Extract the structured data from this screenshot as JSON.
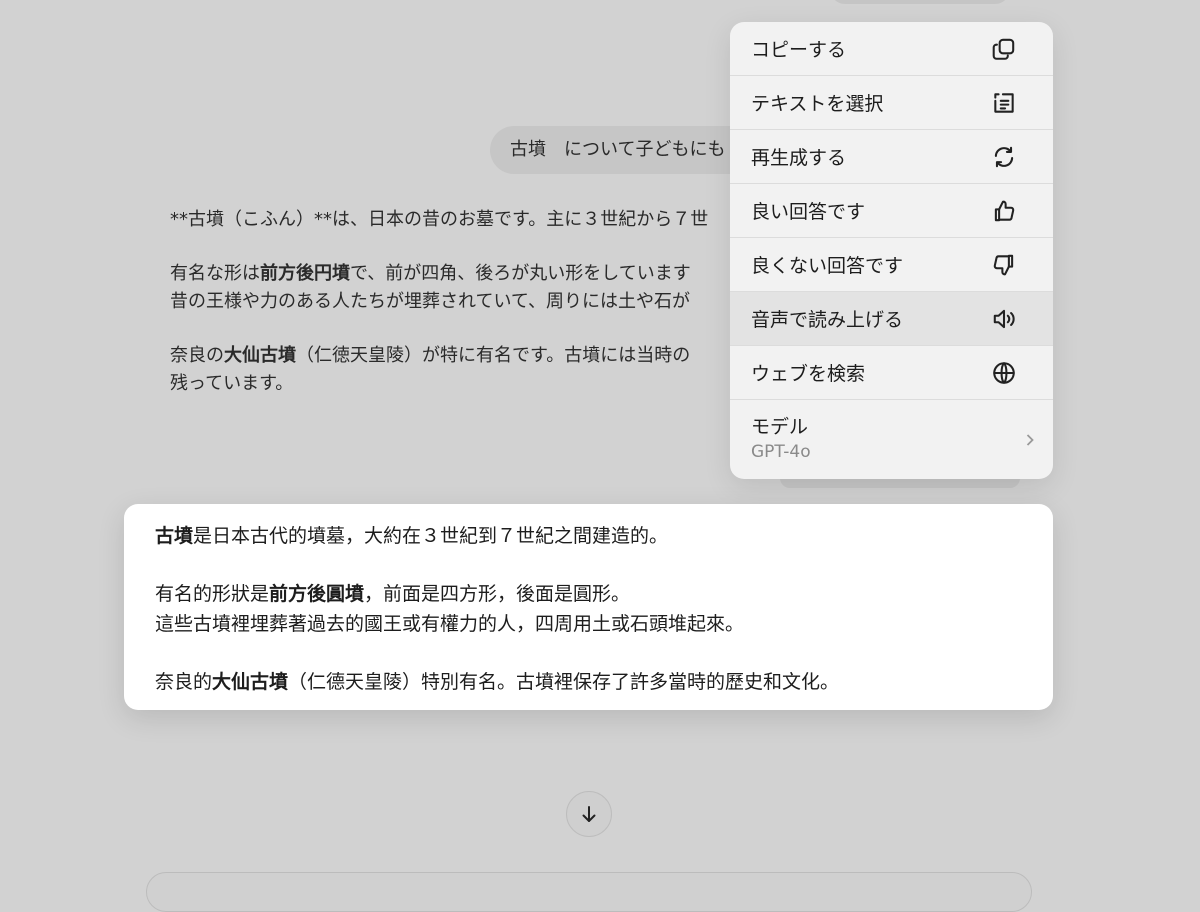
{
  "user_message": "古墳　について子どもにも",
  "answer": {
    "p1": "**古墳（こふん）**は、日本の昔のお墓です。主に３世紀から７世",
    "p2_line1_a": "有名な形は",
    "p2_line1_b": "前方後円墳",
    "p2_line1_c": "で、前が四角、後ろが丸い形をしています",
    "p2_line2": "昔の王様や力のある人たちが埋葬されていて、周りには土や石が",
    "p3_line1_a": "奈良の",
    "p3_line1_b": "大仙古墳",
    "p3_line1_c": "（仁徳天皇陵）が特に有名です。古墳には当時の",
    "p3_line2": "残っています。"
  },
  "menu": {
    "items": [
      {
        "label": "コピーする",
        "icon": "copy-icon"
      },
      {
        "label": "テキストを選択",
        "icon": "select-text-icon"
      },
      {
        "label": "再生成する",
        "icon": "regenerate-icon"
      },
      {
        "label": "良い回答です",
        "icon": "thumbs-up-icon"
      },
      {
        "label": "良くない回答です",
        "icon": "thumbs-down-icon"
      },
      {
        "label": "音声で読み上げる",
        "icon": "speaker-icon"
      },
      {
        "label": "ウェブを検索",
        "icon": "globe-icon"
      }
    ],
    "model": {
      "label": "モデル",
      "value": "GPT-4o",
      "icon": "chevron-right-icon"
    }
  },
  "translation": {
    "p1_a": "古墳",
    "p1_b": "是日本古代的墳墓，大約在３世紀到７世紀之間建造的。",
    "p2_line1_a": "有名的形狀是",
    "p2_line1_b": "前方後圓墳",
    "p2_line1_c": "，前面是四方形，後面是圓形。",
    "p2_line2": "這些古墳裡埋葬著過去的國王或有權力的人，四周用土或石頭堆起來。",
    "p3_a": "奈良的",
    "p3_b": "大仙古墳",
    "p3_c": "（仁德天皇陵）特別有名。古墳裡保存了許多當時的歷史和文化。"
  },
  "scroll_button": {
    "icon": "arrow-down-icon"
  },
  "colors": {
    "background": "#d2d2d2",
    "menu_background": "#f2f2f2",
    "active_item": "#e3e3e3",
    "card_background": "#ffffff"
  }
}
